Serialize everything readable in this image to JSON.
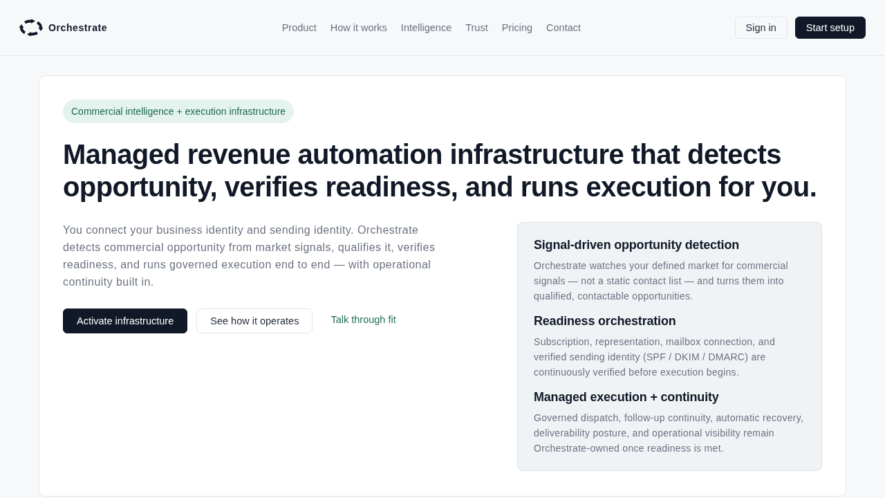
{
  "header": {
    "logo": {
      "name": "Orchestrate"
    },
    "nav": [
      "Product",
      "How it works",
      "Intelligence",
      "Trust",
      "Pricing",
      "Contact"
    ],
    "buttons": [
      {
        "label": "Sign in",
        "kind": "secondary"
      },
      {
        "label": "Start setup",
        "kind": "primary"
      }
    ]
  },
  "hero": {
    "badge": "Commercial intelligence + execution infrastructure",
    "title": "Managed revenue automation infrastructure that detects opportunity, verifies readiness, and runs execution for you.",
    "description": "You connect your business identity and sending identity. Orchestrate detects commercial opportunity from market signals, qualifies it, verifies readiness, and runs governed execution end to end — with operational continuity built in.",
    "actions": [
      {
        "label": "Activate infrastructure",
        "kind": "primary"
      },
      {
        "label": "See how it operates",
        "kind": "secondary"
      },
      {
        "label": "Talk through fit",
        "kind": "link"
      }
    ]
  },
  "features": [
    {
      "title": "Signal-driven opportunity detection",
      "description": "Orchestrate watches your defined market for commercial signals — not a static contact list — and turns them into qualified, contactable opportunities."
    },
    {
      "title": "Readiness orchestration",
      "description": "Subscription, representation, mailbox connection, and verified sending identity (SPF / DKIM / DMARC) are continuously verified before execution begins."
    },
    {
      "title": "Managed execution + continuity",
      "description": "Governed dispatch, follow-up continuity, automatic recovery, deliverability posture, and operational visibility remain Orchestrate-owned once readiness is met."
    }
  ]
}
